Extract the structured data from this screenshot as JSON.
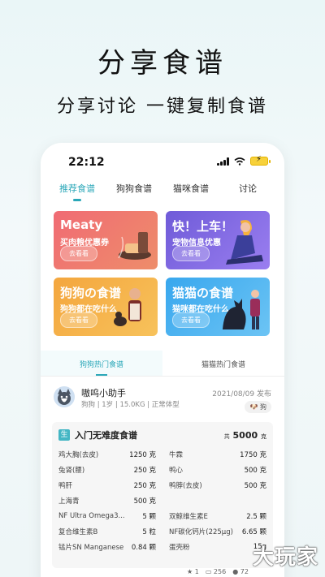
{
  "promo": {
    "headline": "分享食谱",
    "subline": "分享讨论 一键复制食谱"
  },
  "status": {
    "time": "22:12"
  },
  "tabs": [
    {
      "label": "推荐食谱"
    },
    {
      "label": "狗狗食谱"
    },
    {
      "label": "猫咪食谱"
    },
    {
      "label": "讨论"
    }
  ],
  "cards": [
    {
      "title": "Meaty",
      "subtitle": "买肉粮优惠券",
      "button": "去看看"
    },
    {
      "title": "快！上车！",
      "subtitle": "宠物信息优惠",
      "button": "去看看"
    },
    {
      "title": "狗狗の食谱",
      "subtitle": "狗狗都在吃什么",
      "button": "去看看"
    },
    {
      "title": "猫猫の食谱",
      "subtitle": "猫咪都在吃什么",
      "button": "去看看"
    }
  ],
  "subtabs": [
    {
      "label": "狗狗热门食谱"
    },
    {
      "label": "猫猫热门食谱"
    }
  ],
  "post": {
    "username": "嗷呜小助手",
    "meta": "狗狗 | 1岁 | 15.0KG | 正常体型",
    "date": "2021/08/09 发布",
    "tag": "狗"
  },
  "recipe": {
    "badge": "生",
    "title": "入门无难度食谱",
    "total_prefix": "共",
    "total": "5000",
    "total_unit": "克",
    "items": [
      {
        "name": "鸡大胸(去皮)",
        "value": "1250 克"
      },
      {
        "name": "牛霖",
        "value": "1750 克"
      },
      {
        "name": "兔肾(腰)",
        "value": "250 克"
      },
      {
        "name": "鸭心",
        "value": "500 克"
      },
      {
        "name": "鸭肝",
        "value": "250 克"
      },
      {
        "name": "鸭脖(去皮)",
        "value": "500 克"
      },
      {
        "name": "上海青",
        "value": "500 克"
      },
      {
        "name": "",
        "value": ""
      },
      {
        "name": "NF Ultra Omega3...",
        "value": "5 颗"
      },
      {
        "name": "双鲸维生素E",
        "value": "2.5 颗"
      },
      {
        "name": "复合维生素B",
        "value": "5 粒"
      },
      {
        "name": "NF碳化钙片(225μg)",
        "value": "6.65 颗"
      },
      {
        "name": "锰片SN Manganese",
        "value": "0.84 颗"
      },
      {
        "name": "蛋壳粉",
        "value": "15g"
      }
    ]
  },
  "stats": {
    "stars": "1",
    "views": "256",
    "likes": "72"
  },
  "watermark": "大玩家"
}
